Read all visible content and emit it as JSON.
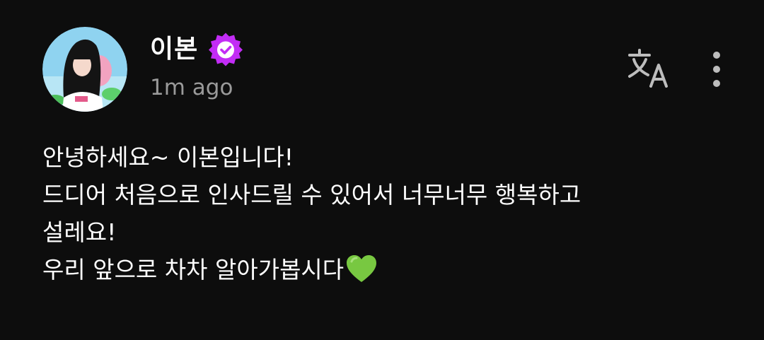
{
  "post": {
    "author": {
      "name": "이본",
      "verified": true,
      "timestamp": "1m ago"
    },
    "actions": {
      "translate_icon": "translate-icon",
      "more_icon": "more-vertical-icon"
    },
    "body": {
      "lines": [
        "안녕하세요~ 이본입니다!",
        "드디어 처음으로 인사드릴 수 있어서 너무너무 행복하고",
        "설레요!",
        "우리 앞으로 차차 알아가봅시다"
      ],
      "trailing_emoji": "green-heart-icon"
    }
  },
  "colors": {
    "background": "#0d0d0d",
    "text": "#ffffff",
    "muted": "#9a9a9a",
    "verified_badge": "#c22cf5",
    "icon": "#bdbdbd",
    "heart": "#78c841"
  }
}
